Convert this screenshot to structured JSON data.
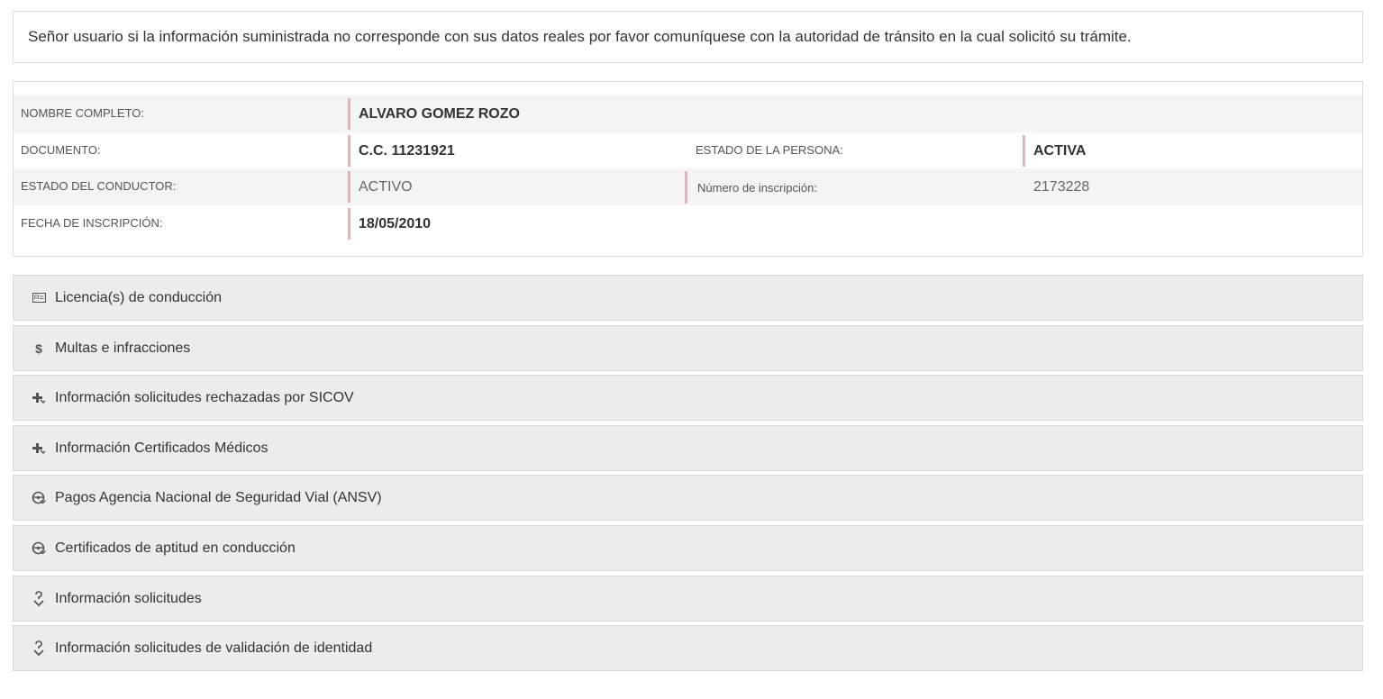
{
  "notice": {
    "text": "Señor usuario si la información suministrada no corresponde con sus datos reales por favor comuníquese con la autoridad de tránsito en la cual solicitó su trámite."
  },
  "person": {
    "nombre_label": "NOMBRE COMPLETO:",
    "nombre_value": "ALVARO GOMEZ ROZO",
    "documento_label": "DOCUMENTO:",
    "documento_value": "C.C. 11231921",
    "estado_persona_label": "ESTADO DE LA PERSONA:",
    "estado_persona_value": "ACTIVA",
    "estado_conductor_label": "ESTADO DEL CONDUCTOR:",
    "estado_conductor_value": "ACTIVO",
    "inscripcion_label": "Número de inscripción:",
    "inscripcion_value": "2173228",
    "fecha_label": "FECHA DE INSCRIPCIÓN:",
    "fecha_value": "18/05/2010"
  },
  "sections": [
    {
      "label": "Licencia(s) de conducción",
      "icon": "id-card-icon"
    },
    {
      "label": "Multas e infracciones",
      "icon": "dollar-icon"
    },
    {
      "label": "Información solicitudes rechazadas por SICOV",
      "icon": "medical-plus-icon"
    },
    {
      "label": "Información Certificados Médicos",
      "icon": "medical-plus-icon"
    },
    {
      "label": "Pagos Agencia Nacional de Seguridad Vial (ANSV)",
      "icon": "steering-wheel-icon"
    },
    {
      "label": "Certificados de aptitud en conducción",
      "icon": "steering-wheel-icon"
    },
    {
      "label": "Información solicitudes",
      "icon": "question-arrow-icon"
    },
    {
      "label": "Información solicitudes de validación de identidad",
      "icon": "question-arrow-icon"
    }
  ],
  "colors": {
    "accent_bar": "#d9b8bd",
    "row_shade": "#f4f4f4",
    "accordion_bg": "#ececec"
  }
}
